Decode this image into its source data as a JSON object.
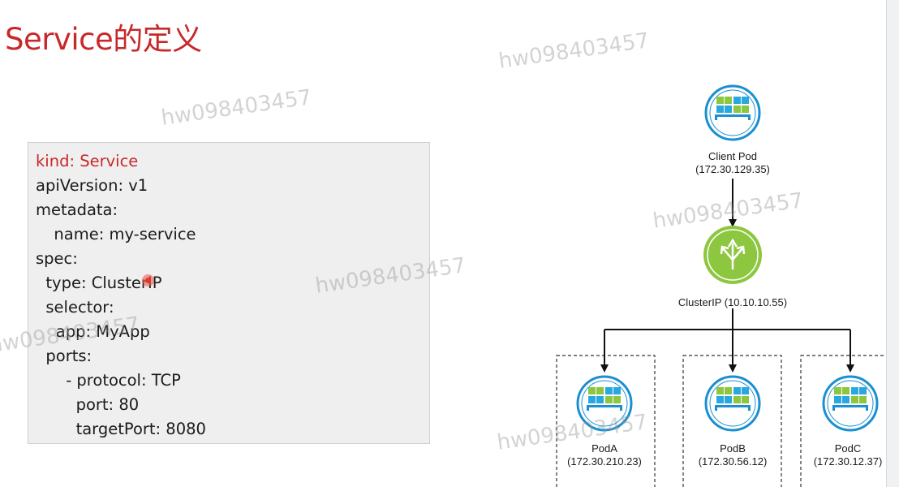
{
  "slide": {
    "title": "Service的定义",
    "title_color": "#c8282a"
  },
  "yaml": {
    "lines": [
      "kind: Service",
      "apiVersion: v1",
      "metadata:",
      "  name: my-service",
      "spec:",
      "  type: ClusterIP",
      "  selector:",
      "    app: MyApp",
      "  ports:",
      "      - protocol: TCP",
      "        port: 80",
      "        targetPort: 8080"
    ],
    "highlight_color": "#c8282a"
  },
  "diagram": {
    "client": {
      "name": "Client Pod",
      "ip": "(172.30.129.35)"
    },
    "service": {
      "name": "ClusterIP (10.10.10.55)",
      "color": "#8dc63f"
    },
    "pods": [
      {
        "name": "PodA",
        "ip": "(172.30.210.23)"
      },
      {
        "name": "PodB",
        "ip": "(172.30.56.12)"
      },
      {
        "name": "PodC",
        "ip": "(172.30.12.37)"
      }
    ],
    "pod_ring_color": "#1a8fd1"
  },
  "watermark": {
    "text": "hw098403457"
  }
}
